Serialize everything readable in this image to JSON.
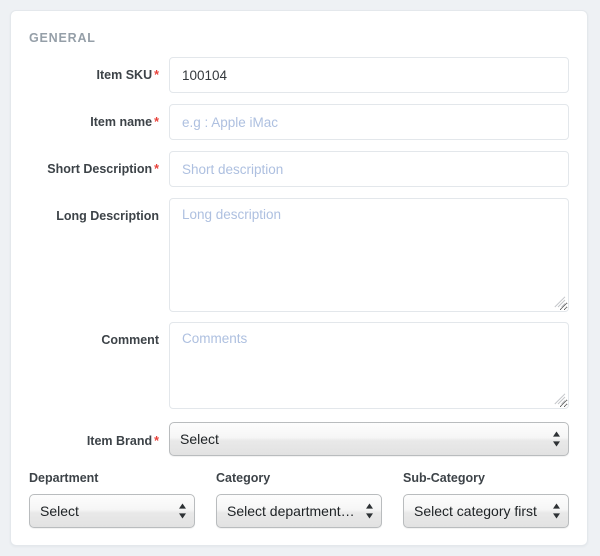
{
  "section": {
    "title": "GENERAL"
  },
  "fields": {
    "item_sku": {
      "label": "Item SKU",
      "required": true,
      "value": "100104",
      "placeholder": ""
    },
    "item_name": {
      "label": "Item name",
      "required": true,
      "value": "",
      "placeholder": "e.g : Apple iMac"
    },
    "short_description": {
      "label": "Short Description",
      "required": true,
      "value": "",
      "placeholder": "Short description"
    },
    "long_description": {
      "label": "Long Description",
      "required": false,
      "value": "",
      "placeholder": "Long description"
    },
    "comment": {
      "label": "Comment",
      "required": false,
      "value": "",
      "placeholder": "Comments"
    },
    "item_brand": {
      "label": "Item Brand",
      "required": true,
      "selected": "Select",
      "options": [
        "Select"
      ]
    }
  },
  "taxonomy": {
    "department": {
      "label": "Department",
      "selected": "Select",
      "options": [
        "Select"
      ]
    },
    "category": {
      "label": "Category",
      "selected": "Select department first",
      "options": [
        "Select department first"
      ]
    },
    "sub_category": {
      "label": "Sub-Category",
      "selected": "Select category first",
      "options": [
        "Select category first"
      ]
    }
  },
  "markers": {
    "required_asterisk": "*"
  },
  "colors": {
    "page_background": "#eef1f4",
    "card_background": "#ffffff",
    "card_border": "#e4e8ec",
    "section_title": "#959fa8",
    "label_text": "#3d4348",
    "required_red": "#e8413a",
    "input_border": "#e3e7eb",
    "placeholder_text": "#aec0e0",
    "value_text": "#34393d",
    "select_border": "#b9bcbe",
    "select_background": "#ececec"
  }
}
